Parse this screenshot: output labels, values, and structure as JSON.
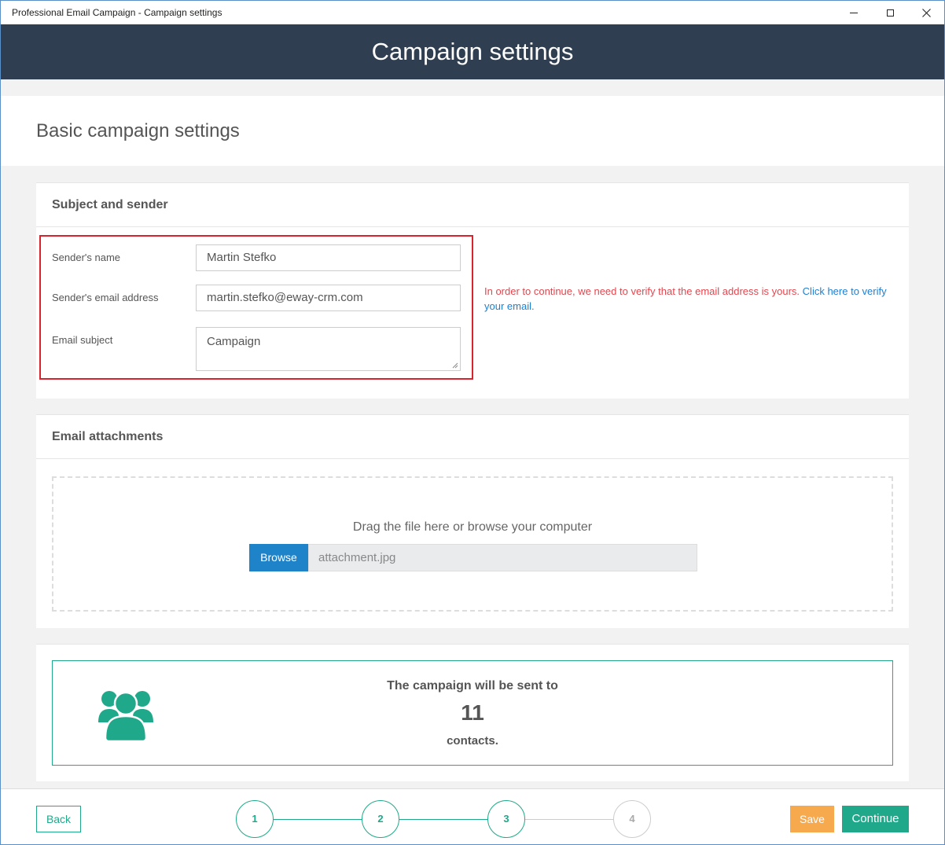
{
  "window": {
    "title": "Professional Email Campaign - Campaign settings"
  },
  "header": {
    "title": "Campaign settings"
  },
  "page": {
    "title": "Basic campaign settings"
  },
  "subject_sender": {
    "heading": "Subject and sender",
    "sender_name_label": "Sender's name",
    "sender_name_value": "Martin Stefko",
    "sender_email_label": "Sender's email address",
    "sender_email_value": "martin.stefko@eway-crm.com",
    "subject_label": "Email subject",
    "subject_value": "Campaign",
    "verify_message": "In order to continue, we need to verify that the email address is yours. ",
    "verify_link": "Click here to verify your email",
    "verify_period": "."
  },
  "attachments": {
    "heading": "Email attachments",
    "drop_text": "Drag the file here or browse your computer",
    "browse_label": "Browse",
    "file_name": "attachment.jpg"
  },
  "recipients": {
    "line1": "The campaign will be sent to",
    "count": "11",
    "line2": "contacts."
  },
  "footer": {
    "back_label": "Back",
    "save_label": "Save",
    "continue_label": "Continue",
    "steps": [
      "1",
      "2",
      "3",
      "4"
    ]
  },
  "colors": {
    "accent": "#1fa98a",
    "header_bg": "#2f3e50",
    "warning": "#e2474f",
    "link": "#1f7fd1",
    "browse": "#1e83c9",
    "save": "#f7a94e"
  }
}
